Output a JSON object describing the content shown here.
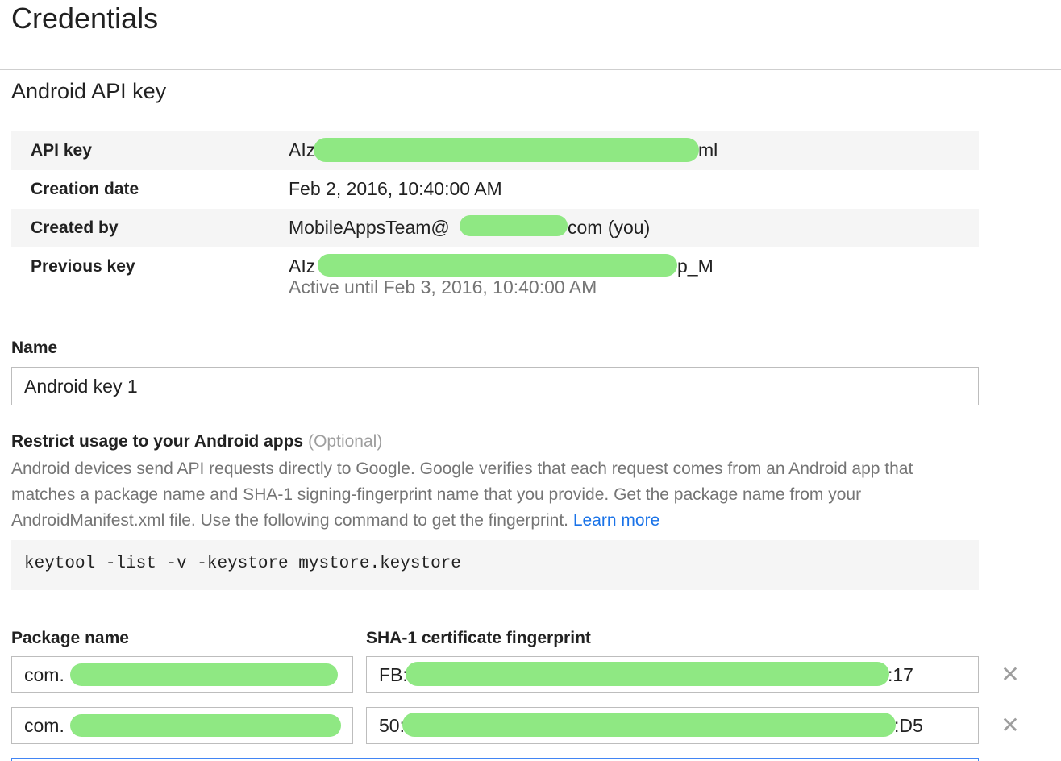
{
  "header": {
    "title": "Credentials"
  },
  "section": {
    "title": "Android API key"
  },
  "key_info": {
    "rows": [
      {
        "label": "API key",
        "value_prefix": "AIza",
        "value_suffix": "ml"
      },
      {
        "label": "Creation date",
        "value": "Feb 2, 2016, 10:40:00 AM"
      },
      {
        "label": "Created by",
        "value_prefix": "MobileAppsTeam@",
        "value_suffix": "com (you)"
      },
      {
        "label": "Previous key",
        "value_prefix": "AIz",
        "value_suffix": "p_M",
        "sub": "Active until Feb 3, 2016, 10:40:00 AM"
      }
    ]
  },
  "name_field": {
    "label": "Name",
    "value": "Android key 1"
  },
  "restrict": {
    "heading": "Restrict usage to your Android apps",
    "optional": "(Optional)",
    "description_lines": [
      "Android devices send API requests directly to Google. Google verifies that each request comes from an Android app that",
      "matches a package name and SHA-1 signing-fingerprint name that you provide. Get the package name from your",
      "AndroidManifest.xml file. Use the following command to get the fingerprint."
    ],
    "learn_more": "Learn more",
    "command": "keytool -list -v -keystore mystore.keystore"
  },
  "apps_table": {
    "package_header": "Package name",
    "sha_header": "SHA-1 certificate fingerprint",
    "rows": [
      {
        "package_prefix": "com.",
        "sha_prefix": "FB:",
        "sha_suffix": ":17",
        "remove_label": "✕"
      },
      {
        "package_prefix": "com.",
        "sha_prefix": "50:",
        "sha_suffix": ":D5",
        "remove_label": "✕"
      }
    ]
  },
  "colors": {
    "redaction": "#8fe883",
    "link": "#1a73e8",
    "focus_border": "#4285f4"
  }
}
